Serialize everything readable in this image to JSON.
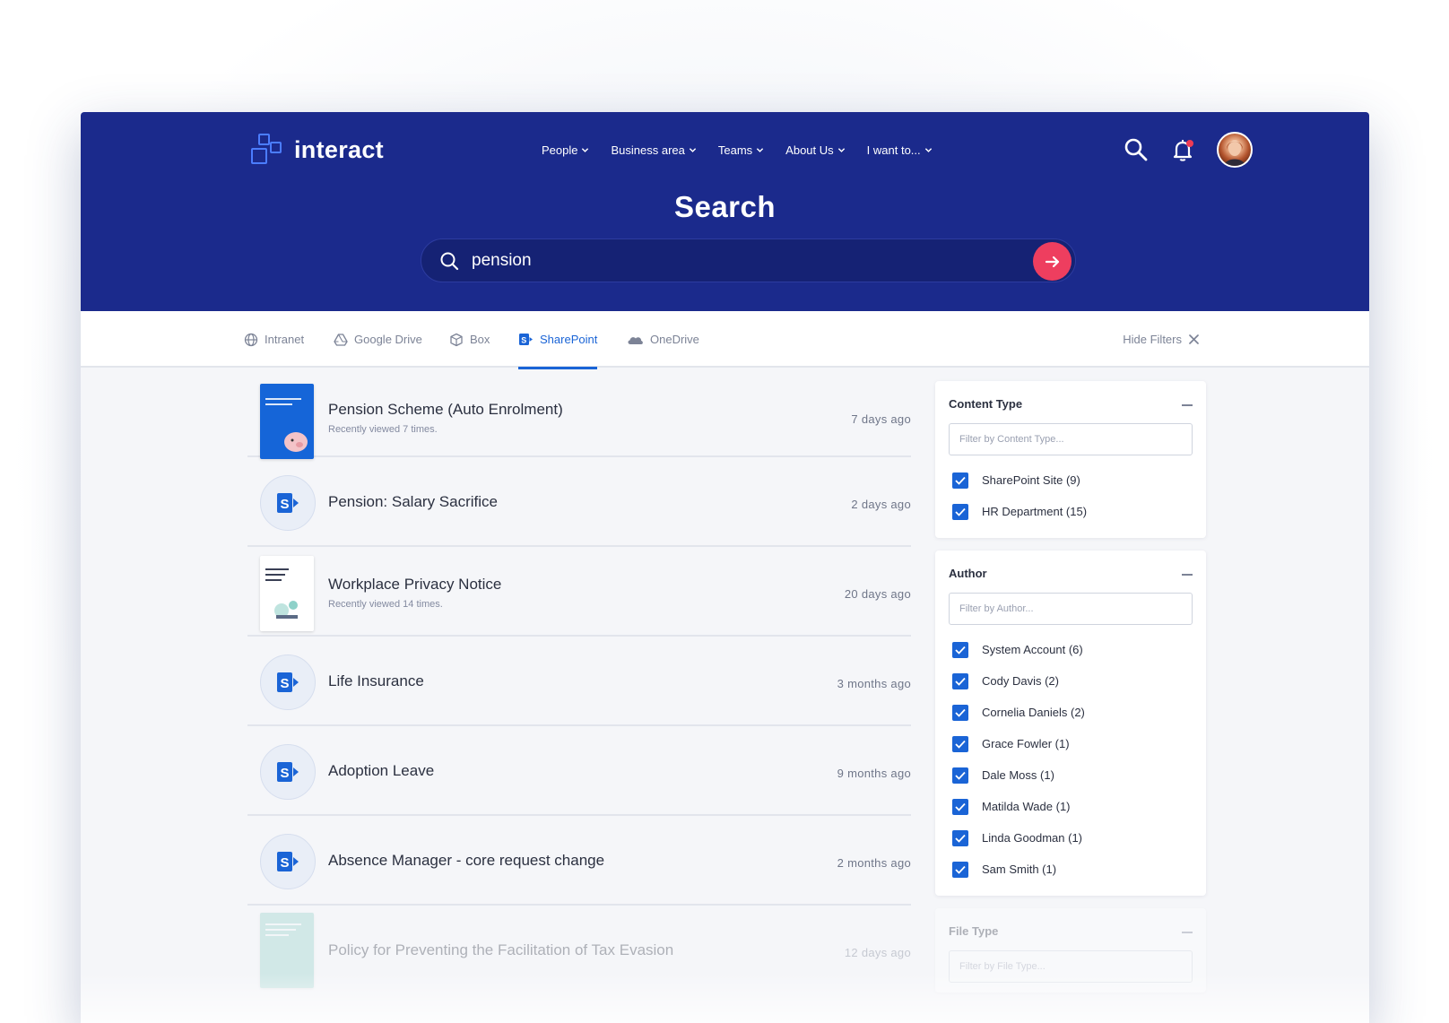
{
  "brand": {
    "name": "interact"
  },
  "nav": [
    "People",
    "Business area",
    "Teams",
    "About Us",
    "I want to..."
  ],
  "page": {
    "title": "Search"
  },
  "search": {
    "value": "pension"
  },
  "tabs": [
    {
      "label": "Intranet",
      "icon": "globe-icon"
    },
    {
      "label": "Google Drive",
      "icon": "google-drive-icon"
    },
    {
      "label": "Box",
      "icon": "box-icon"
    },
    {
      "label": "SharePoint",
      "icon": "sharepoint-icon",
      "active": true
    },
    {
      "label": "OneDrive",
      "icon": "onedrive-icon"
    }
  ],
  "hide_filters": "Hide Filters",
  "results": [
    {
      "title": "Pension Scheme (Auto Enrolment)",
      "sub": "Recently viewed 7 times.",
      "date": "7 days ago",
      "thumb": "document-thumbnail"
    },
    {
      "title": "Pension: Salary Sacrifice",
      "date": "2 days ago",
      "thumb": "sharepoint-icon"
    },
    {
      "title": "Workplace Privacy Notice",
      "sub": "Recently viewed 14 times.",
      "date": "20 days ago",
      "thumb": "document-thumbnail"
    },
    {
      "title": "Life Insurance",
      "date": "3 months ago",
      "thumb": "sharepoint-icon"
    },
    {
      "title": "Adoption Leave",
      "date": "9 months ago",
      "thumb": "sharepoint-icon"
    },
    {
      "title": "Absence Manager - core request change",
      "date": "2 months ago",
      "thumb": "sharepoint-icon"
    },
    {
      "title": "Policy for Preventing the Facilitation of Tax Evasion",
      "date": "12 days ago",
      "thumb": "document-thumbnail"
    }
  ],
  "filters": {
    "content_type": {
      "title": "Content Type",
      "placeholder": "Filter by Content Type...",
      "options": [
        "SharePoint Site (9)",
        "HR Department (15)"
      ]
    },
    "author": {
      "title": "Author",
      "placeholder": "Filter by Author...",
      "options": [
        "System Account (6)",
        "Cody Davis (2)",
        "Cornelia Daniels (2)",
        "Grace Fowler (1)",
        "Dale Moss (1)",
        "Matilda Wade (1)",
        "Linda Goodman (1)",
        "Sam Smith (1)"
      ]
    },
    "file_type": {
      "title": "File Type",
      "placeholder": "Filter by File Type..."
    }
  },
  "colors": {
    "header": "#1b2a8c",
    "accent": "#1a64d6",
    "go_button": "#ee3e5f"
  }
}
